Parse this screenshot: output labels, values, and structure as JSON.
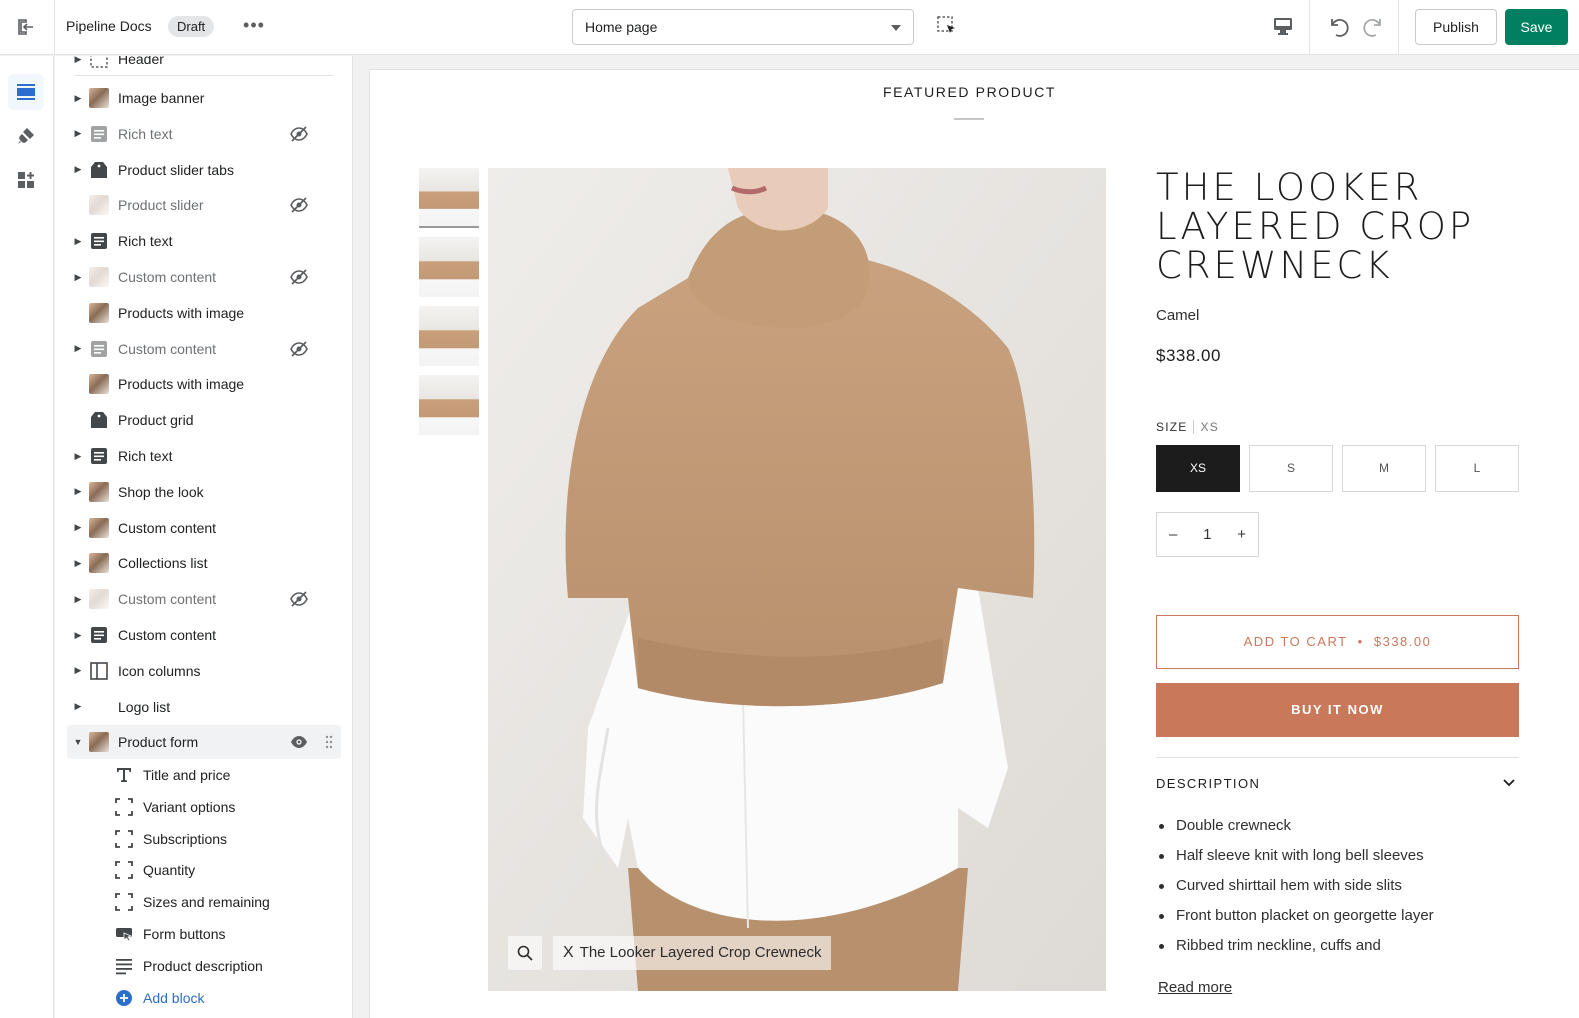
{
  "topbar": {
    "store_name": "Pipeline Docs",
    "status_badge": "Draft",
    "more_label": "•••",
    "page_selector": "Home page",
    "publish_label": "Publish",
    "save_label": "Save",
    "save_color": "#008060"
  },
  "rail": {
    "items": [
      "sections-icon",
      "theme-settings-icon",
      "app-embeds-icon"
    ],
    "active_color": "#2c6ecb"
  },
  "sidebar": {
    "header_partial": "Header",
    "sections": [
      {
        "label": "Image banner",
        "hidden": false,
        "expandable": true,
        "icon": "image-thumb"
      },
      {
        "label": "Rich text",
        "hidden": true,
        "expandable": true,
        "icon": "text-icon"
      },
      {
        "label": "Product slider tabs",
        "hidden": false,
        "expandable": true,
        "icon": "tag-icon"
      },
      {
        "label": "Product slider",
        "hidden": true,
        "expandable": false,
        "icon": "image-thumb"
      },
      {
        "label": "Rich text",
        "hidden": false,
        "expandable": true,
        "icon": "text-icon"
      },
      {
        "label": "Custom content",
        "hidden": true,
        "expandable": true,
        "icon": "image-thumb"
      },
      {
        "label": "Products with image",
        "hidden": false,
        "expandable": false,
        "icon": "image-thumb"
      },
      {
        "label": "Custom content",
        "hidden": true,
        "expandable": true,
        "icon": "text-icon"
      },
      {
        "label": "Products with image",
        "hidden": false,
        "expandable": false,
        "icon": "image-thumb"
      },
      {
        "label": "Product grid",
        "hidden": false,
        "expandable": false,
        "icon": "tag-icon"
      },
      {
        "label": "Rich text",
        "hidden": false,
        "expandable": true,
        "icon": "text-icon"
      },
      {
        "label": "Shop the look",
        "hidden": false,
        "expandable": true,
        "icon": "image-thumb"
      },
      {
        "label": "Custom content",
        "hidden": false,
        "expandable": true,
        "icon": "image-thumb"
      },
      {
        "label": "Collections list",
        "hidden": false,
        "expandable": true,
        "icon": "image-thumb"
      },
      {
        "label": "Custom content",
        "hidden": true,
        "expandable": true,
        "icon": "image-thumb"
      },
      {
        "label": "Custom content",
        "hidden": false,
        "expandable": true,
        "icon": "text-icon"
      },
      {
        "label": "Icon columns",
        "hidden": false,
        "expandable": true,
        "icon": "columns-icon"
      },
      {
        "label": "Logo list",
        "hidden": false,
        "expandable": true,
        "icon": "none"
      },
      {
        "label": "Product form",
        "hidden": false,
        "expandable": true,
        "icon": "image-thumb",
        "selected": true
      }
    ],
    "blocks": [
      {
        "label": "Title and price",
        "icon": "title-icon"
      },
      {
        "label": "Variant options",
        "icon": "block-icon"
      },
      {
        "label": "Subscriptions",
        "icon": "block-icon"
      },
      {
        "label": "Quantity",
        "icon": "block-icon"
      },
      {
        "label": "Sizes and remaining",
        "icon": "block-icon"
      },
      {
        "label": "Form buttons",
        "icon": "button-icon"
      },
      {
        "label": "Product description",
        "icon": "lines-icon"
      }
    ],
    "add_block_label": "Add block"
  },
  "preview": {
    "section_heading": "FEATURED PRODUCT",
    "product_title": "The Looker Layered Crop Crewneck",
    "variant_color": "Camel",
    "price": "$338.00",
    "size_label": "SIZE",
    "size_selected": "XS",
    "sizes": [
      "XS",
      "S",
      "M",
      "L"
    ],
    "quantity": "1",
    "qty_minus": "–",
    "qty_plus": "+",
    "add_to_cart_label": "ADD TO CART",
    "add_to_cart_sep": "•",
    "add_to_cart_price": "$338.00",
    "buy_now_label": "BUY IT NOW",
    "accent_color": "#c9795a",
    "description_heading": "DESCRIPTION",
    "description_bullets": [
      "Double crewneck",
      "Half sleeve knit with long bell sleeves",
      "Curved shirttail hem with side slits",
      "Front button placket on georgette layer",
      "Ribbed trim neckline, cuffs and"
    ],
    "read_more_label": "Read more",
    "image_caption": "The Looker Layered Crop Crewneck",
    "caption_close": "X"
  }
}
